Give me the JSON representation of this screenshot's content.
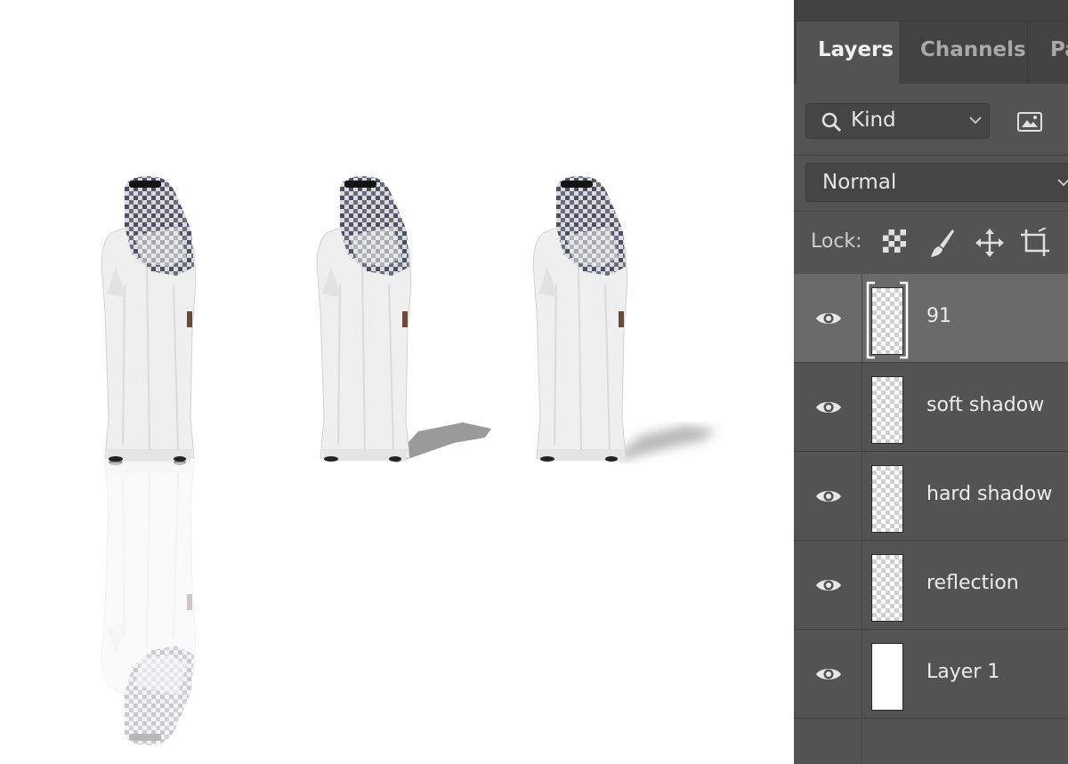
{
  "panel": {
    "tabs": [
      {
        "label": "Layers",
        "active": true
      },
      {
        "label": "Channels",
        "active": false
      },
      {
        "label": "Pa",
        "active": false
      }
    ],
    "filter": {
      "kind_label": "Kind",
      "search_icon": "search-icon",
      "image_filter_icon": "image-filter-icon"
    },
    "blend_mode": {
      "value": "Normal"
    },
    "lock": {
      "label": "Lock:",
      "icons": [
        "lock-transparent-pixels-icon",
        "lock-image-pixels-icon",
        "lock-position-icon",
        "lock-artboard-icon"
      ]
    },
    "layers": [
      {
        "name": "91",
        "visible": true,
        "selected": true,
        "thumb": "smart-object"
      },
      {
        "name": "soft shadow",
        "visible": true,
        "selected": false,
        "thumb": "transparent"
      },
      {
        "name": "hard shadow",
        "visible": true,
        "selected": false,
        "thumb": "transparent"
      },
      {
        "name": "reflection",
        "visible": true,
        "selected": false,
        "thumb": "transparent"
      },
      {
        "name": "Layer 1",
        "visible": true,
        "selected": false,
        "thumb": "white"
      }
    ]
  },
  "colors": {
    "panel_bg": "#535353",
    "tab_bar_bg": "#424242",
    "selected_layer": "#6a6a6a",
    "text": "#ececec"
  }
}
